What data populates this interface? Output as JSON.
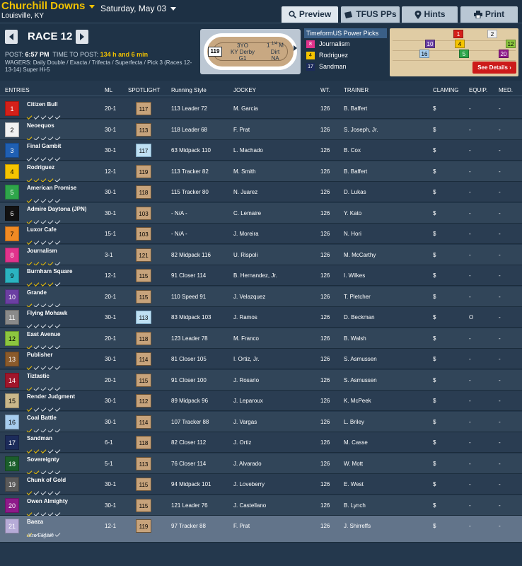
{
  "header": {
    "track": "Churchill Downs",
    "date": "Saturday, May 03",
    "location": "Louisville, KY"
  },
  "tabs": [
    {
      "label": "Preview",
      "icon": "search-icon"
    },
    {
      "label": "TFUS PPs",
      "icon": "ticket-icon"
    },
    {
      "label": "Hints",
      "icon": "pin-icon"
    },
    {
      "label": "Print",
      "icon": "printer-icon"
    }
  ],
  "race": {
    "label": "RACE 12",
    "post_label": "POST:",
    "post_time": "6:57 PM",
    "ttp_label": "TIME TO POST:",
    "ttp": "134 h and 6 min",
    "wagers_label": "WAGERS:",
    "wagers": "Daily Double / Exacta / Trifecta / Superfecta / Pick 3 (Races 12-13-14) Super Hi-5"
  },
  "oval": {
    "num": "119",
    "line1": "3YO",
    "line2": "KY Derby",
    "line3": "G1",
    "dist_a": "1",
    "dist_frac": "1/4",
    "dist_b": "M",
    "surface": "Dirt",
    "extra": "NA"
  },
  "power_picks": {
    "title": "TimeformUS Power Picks",
    "picks": [
      {
        "num": "8",
        "name": "Journalism",
        "color": "#e0338c",
        "text": "#fff"
      },
      {
        "num": "4",
        "name": "Rodriguez",
        "color": "#f5c400",
        "text": "#000"
      },
      {
        "num": "17",
        "name": "Sandman",
        "color": "#1c2b5a",
        "text": "#fff"
      }
    ]
  },
  "mini_chart": {
    "details_label": "See Details ›",
    "horses": [
      "1",
      "2",
      "10",
      "4",
      "12",
      "16",
      "5",
      "20"
    ]
  },
  "columns": {
    "entries": "ENTRIES",
    "ml": "ML",
    "spotlight": "SPOTLIGHT",
    "style": "Running Style",
    "jockey": "JOCKEY",
    "wt": "WT.",
    "trainer": "TRAINER",
    "claiming": "CLAMING",
    "equip": "EQUIP.",
    "med": "MED."
  },
  "entries": [
    {
      "pp": "1",
      "name": "Citizen Bull",
      "checks": "YWWWW",
      "ml": "20-1",
      "spot": "117",
      "style": "113 Leader 72",
      "jockey": "M. Garcia",
      "wt": "126",
      "trainer": "B. Baffert",
      "claim": "$",
      "equip": "-",
      "med": "-",
      "bg": "#d4201a",
      "fg": "#fff"
    },
    {
      "pp": "2",
      "name": "Neoequos",
      "checks": "YWWWW",
      "ml": "30-1",
      "spot": "113",
      "style": "118 Leader 68",
      "jockey": "F. Prat",
      "wt": "126",
      "trainer": "S. Joseph, Jr.",
      "claim": "$",
      "equip": "-",
      "med": "-",
      "bg": "#f2f2f2",
      "fg": "#000"
    },
    {
      "pp": "3",
      "name": "Final Gambit",
      "checks": "WWWWW",
      "ml": "30-1",
      "spot": "117",
      "style": "63 Midpack 110",
      "jockey": "L. Machado",
      "wt": "126",
      "trainer": "B. Cox",
      "claim": "$",
      "equip": "-",
      "med": "-",
      "bg": "#1f5fb3",
      "fg": "#fff",
      "light": true
    },
    {
      "pp": "4",
      "name": "Rodriguez",
      "checks": "YYYYW",
      "ml": "12-1",
      "spot": "119",
      "style": "113 Tracker 82",
      "jockey": "M. Smith",
      "wt": "126",
      "trainer": "B. Baffert",
      "claim": "$",
      "equip": "-",
      "med": "-",
      "bg": "#f5c400",
      "fg": "#000"
    },
    {
      "pp": "5",
      "name": "American Promise",
      "checks": "YWWWW",
      "ml": "30-1",
      "spot": "118",
      "style": "115 Tracker 80",
      "jockey": "N. Juarez",
      "wt": "126",
      "trainer": "D. Lukas",
      "claim": "$",
      "equip": "-",
      "med": "-",
      "bg": "#2ea54a",
      "fg": "#fff"
    },
    {
      "pp": "6",
      "name": "Admire Daytona (JPN)",
      "checks": "YWWWW",
      "ml": "30-1",
      "spot": "103",
      "style": "- N/A -",
      "jockey": "C. Lemaire",
      "wt": "126",
      "trainer": "Y. Kato",
      "claim": "$",
      "equip": "-",
      "med": "-",
      "bg": "#111111",
      "fg": "#fff"
    },
    {
      "pp": "7",
      "name": "Luxor Cafe",
      "checks": "YWWWW",
      "ml": "15-1",
      "spot": "103",
      "style": "- N/A -",
      "jockey": "J. Moreira",
      "wt": "126",
      "trainer": "N. Hori",
      "claim": "$",
      "equip": "-",
      "med": "-",
      "bg": "#f08a24",
      "fg": "#000"
    },
    {
      "pp": "8",
      "name": "Journalism",
      "checks": "YYYYW",
      "ml": "3-1",
      "spot": "121",
      "style": "82 Midpack 116",
      "jockey": "U. Rispoli",
      "wt": "126",
      "trainer": "M. McCarthy",
      "claim": "$",
      "equip": "-",
      "med": "-",
      "bg": "#e0338c",
      "fg": "#fff"
    },
    {
      "pp": "9",
      "name": "Burnham Square",
      "checks": "YYYYW",
      "ml": "12-1",
      "spot": "115",
      "style": "91 Closer 114",
      "jockey": "B. Hernandez, Jr.",
      "wt": "126",
      "trainer": "I. Wilkes",
      "claim": "$",
      "equip": "-",
      "med": "-",
      "bg": "#2bb3c0",
      "fg": "#000"
    },
    {
      "pp": "10",
      "name": "Grande",
      "checks": "YWWWW",
      "ml": "20-1",
      "spot": "115",
      "style": "110 Speed 91",
      "jockey": "J. Velazquez",
      "wt": "126",
      "trainer": "T. Pletcher",
      "claim": "$",
      "equip": "-",
      "med": "-",
      "bg": "#6b3fa3",
      "fg": "#fff"
    },
    {
      "pp": "11",
      "name": "Flying Mohawk",
      "checks": "WWWWW",
      "ml": "30-1",
      "spot": "113",
      "style": "83 Midpack 103",
      "jockey": "J. Ramos",
      "wt": "126",
      "trainer": "D. Beckman",
      "claim": "$",
      "equip": "O",
      "med": "-",
      "bg": "#8a8a8a",
      "fg": "#fff",
      "light": true
    },
    {
      "pp": "12",
      "name": "East Avenue",
      "checks": "YWWWW",
      "ml": "20-1",
      "spot": "118",
      "style": "123 Leader 78",
      "jockey": "M. Franco",
      "wt": "126",
      "trainer": "B. Walsh",
      "claim": "$",
      "equip": "-",
      "med": "-",
      "bg": "#8cc63f",
      "fg": "#000"
    },
    {
      "pp": "13",
      "name": "Publisher",
      "checks": "YWWWW",
      "ml": "30-1",
      "spot": "114",
      "style": "81 Closer 105",
      "jockey": "I. Ortiz, Jr.",
      "wt": "126",
      "trainer": "S. Asmussen",
      "claim": "$",
      "equip": "-",
      "med": "-",
      "bg": "#8a5a2b",
      "fg": "#fff"
    },
    {
      "pp": "14",
      "name": "Tiztastic",
      "checks": "YWWWW",
      "ml": "20-1",
      "spot": "115",
      "style": "91 Closer 100",
      "jockey": "J. Rosario",
      "wt": "126",
      "trainer": "S. Asmussen",
      "claim": "$",
      "equip": "-",
      "med": "-",
      "bg": "#a0162b",
      "fg": "#fff"
    },
    {
      "pp": "15",
      "name": "Render Judgment",
      "checks": "YWWWW",
      "ml": "30-1",
      "spot": "112",
      "style": "89 Midpack 96",
      "jockey": "J. Leparoux",
      "wt": "126",
      "trainer": "K. McPeek",
      "claim": "$",
      "equip": "-",
      "med": "-",
      "bg": "#c9b78a",
      "fg": "#000"
    },
    {
      "pp": "16",
      "name": "Coal Battle",
      "checks": "YWWWW",
      "ml": "30-1",
      "spot": "114",
      "style": "107 Tracker 88",
      "jockey": "J. Vargas",
      "wt": "126",
      "trainer": "L. Briley",
      "claim": "$",
      "equip": "-",
      "med": "-",
      "bg": "#a7cdee",
      "fg": "#000"
    },
    {
      "pp": "17",
      "name": "Sandman",
      "checks": "YYYWW",
      "ml": "6-1",
      "spot": "118",
      "style": "82 Closer 112",
      "jockey": "J. Ortiz",
      "wt": "126",
      "trainer": "M. Casse",
      "claim": "$",
      "equip": "-",
      "med": "-",
      "bg": "#1c2b5a",
      "fg": "#fff"
    },
    {
      "pp": "18",
      "name": "Sovereignty",
      "checks": "YYWWW",
      "ml": "5-1",
      "spot": "113",
      "style": "76 Closer 114",
      "jockey": "J. Alvarado",
      "wt": "126",
      "trainer": "W. Mott",
      "claim": "$",
      "equip": "-",
      "med": "-",
      "bg": "#1b5e2b",
      "fg": "#fff"
    },
    {
      "pp": "19",
      "name": "Chunk of Gold",
      "checks": "YWWWW",
      "ml": "30-1",
      "spot": "115",
      "style": "94 Midpack 101",
      "jockey": "J. Loveberry",
      "wt": "126",
      "trainer": "E. West",
      "claim": "$",
      "equip": "-",
      "med": "-",
      "bg": "#5a5a5a",
      "fg": "#fff"
    },
    {
      "pp": "20",
      "name": "Owen Almighty",
      "checks": "YWWWW",
      "ml": "30-1",
      "spot": "115",
      "style": "121 Leader 76",
      "jockey": "J. Castellano",
      "wt": "126",
      "trainer": "B. Lynch",
      "claim": "$",
      "equip": "-",
      "med": "-",
      "bg": "#8e1a8a",
      "fg": "#fff"
    },
    {
      "pp": "21",
      "name": "Baeza",
      "checks": "YWWWW",
      "ml": "12-1",
      "spot": "119",
      "style": "97 Tracker 88",
      "jockey": "F. Prat",
      "wt": "126",
      "trainer": "J. Shirreffs",
      "claim": "$",
      "equip": "-",
      "med": "-",
      "bg": "#b6abd7",
      "fg": "#fff",
      "also": "Also Eligible"
    }
  ]
}
